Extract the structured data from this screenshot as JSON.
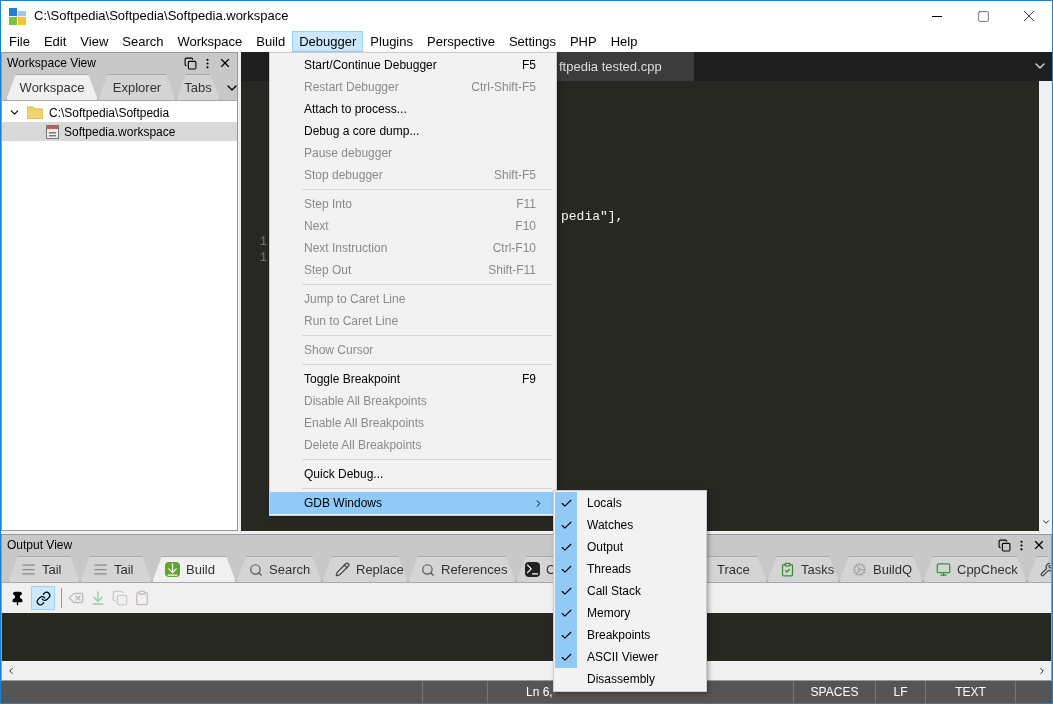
{
  "window": {
    "title": "C:\\Softpedia\\Softpedia\\Softpedia.workspace"
  },
  "menu_bar": [
    {
      "label": "File",
      "selected": false
    },
    {
      "label": "Edit",
      "selected": false
    },
    {
      "label": "View",
      "selected": false
    },
    {
      "label": "Search",
      "selected": false
    },
    {
      "label": "Workspace",
      "selected": false
    },
    {
      "label": "Build",
      "selected": false
    },
    {
      "label": "Debugger",
      "selected": true
    },
    {
      "label": "Plugins",
      "selected": false
    },
    {
      "label": "Perspective",
      "selected": false
    },
    {
      "label": "Settings",
      "selected": false
    },
    {
      "label": "PHP",
      "selected": false
    },
    {
      "label": "Help",
      "selected": false
    }
  ],
  "workspace_view": {
    "title": "Workspace View",
    "tabs": [
      {
        "label": "Workspace",
        "selected": true
      },
      {
        "label": "Explorer",
        "selected": false
      },
      {
        "label": "Tabs",
        "selected": false
      }
    ],
    "tree": [
      {
        "label": "C:\\Softpedia\\Softpedia",
        "expanded": true,
        "children": [
          {
            "label": "Softpedia.workspace",
            "selected": true
          }
        ]
      }
    ]
  },
  "editor": {
    "tab": "ftpedia tested.cpp",
    "line_numbers": [
      "1",
      "1"
    ],
    "code_fragment": "pedia\"],"
  },
  "debugger_menu": [
    {
      "kind": "item",
      "label": "Start/Continue Debugger",
      "shortcut": "F5",
      "disabled": false
    },
    {
      "kind": "item",
      "label": "Restart Debugger",
      "shortcut": "Ctrl-Shift-F5",
      "disabled": true
    },
    {
      "kind": "item",
      "label": "Attach to process...",
      "disabled": false
    },
    {
      "kind": "item",
      "label": "Debug a core dump...",
      "disabled": false
    },
    {
      "kind": "item",
      "label": "Pause debugger",
      "disabled": true
    },
    {
      "kind": "item",
      "label": "Stop debugger",
      "shortcut": "Shift-F5",
      "disabled": true
    },
    {
      "kind": "separator"
    },
    {
      "kind": "item",
      "label": "Step Into",
      "shortcut": "F11",
      "disabled": true
    },
    {
      "kind": "item",
      "label": "Next",
      "shortcut": "F10",
      "disabled": true
    },
    {
      "kind": "item",
      "label": "Next Instruction",
      "shortcut": "Ctrl-F10",
      "disabled": true
    },
    {
      "kind": "item",
      "label": "Step Out",
      "shortcut": "Shift-F11",
      "disabled": true
    },
    {
      "kind": "separator"
    },
    {
      "kind": "item",
      "label": "Jump to Caret Line",
      "disabled": true
    },
    {
      "kind": "item",
      "label": "Run to Caret Line",
      "disabled": true
    },
    {
      "kind": "separator"
    },
    {
      "kind": "item",
      "label": "Show Cursor",
      "disabled": true
    },
    {
      "kind": "separator"
    },
    {
      "kind": "item",
      "label": "Toggle Breakpoint",
      "shortcut": "F9",
      "disabled": false
    },
    {
      "kind": "item",
      "label": "Disable All Breakpoints",
      "disabled": true
    },
    {
      "kind": "item",
      "label": "Enable All Breakpoints",
      "disabled": true
    },
    {
      "kind": "item",
      "label": "Delete All Breakpoints",
      "disabled": true
    },
    {
      "kind": "separator"
    },
    {
      "kind": "item",
      "label": "Quick Debug...",
      "disabled": false
    },
    {
      "kind": "separator"
    },
    {
      "kind": "submenu",
      "label": "GDB Windows",
      "disabled": false,
      "selected": true
    }
  ],
  "gdb_windows_submenu": [
    {
      "label": "Locals",
      "checked": true
    },
    {
      "label": "Watches",
      "checked": true
    },
    {
      "label": "Output",
      "checked": true
    },
    {
      "label": "Threads",
      "checked": true
    },
    {
      "label": "Call Stack",
      "checked": true
    },
    {
      "label": "Memory",
      "checked": true
    },
    {
      "label": "Breakpoints",
      "checked": true
    },
    {
      "label": "ASCII Viewer",
      "checked": true
    },
    {
      "label": "Disassembly",
      "checked": false
    }
  ],
  "output_view": {
    "title": "Output View",
    "tabs": [
      {
        "label": "Tail",
        "selected": false
      },
      {
        "label": "Tail",
        "selected": false
      },
      {
        "label": "Build",
        "selected": true
      },
      {
        "label": "Search",
        "selected": false
      },
      {
        "label": "Replace",
        "selected": false
      },
      {
        "label": "References",
        "selected": false
      },
      {
        "label": "C",
        "selected": false
      },
      {
        "label": "Trace",
        "selected": false
      },
      {
        "label": "Tasks",
        "selected": false
      },
      {
        "label": "BuildQ",
        "selected": false
      },
      {
        "label": "CppCheck",
        "selected": false
      },
      {
        "selected": false
      }
    ]
  },
  "status_bar": {
    "position": "Ln 6,",
    "indent": "SPACES",
    "eol": "LF",
    "mode": "TEXT"
  }
}
